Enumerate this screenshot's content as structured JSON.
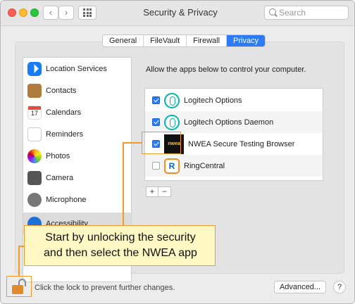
{
  "window": {
    "title": "Security & Privacy"
  },
  "toolbar": {
    "back_glyph": "‹",
    "forward_glyph": "›",
    "grid_icon": "grid-icon"
  },
  "search": {
    "placeholder": "Search"
  },
  "tabs": [
    {
      "label": "General",
      "active": false
    },
    {
      "label": "FileVault",
      "active": false
    },
    {
      "label": "Firewall",
      "active": false
    },
    {
      "label": "Privacy",
      "active": true
    }
  ],
  "sidebar": {
    "items": [
      {
        "label": "Location Services",
        "icon": "location-icon"
      },
      {
        "label": "Contacts",
        "icon": "contacts-icon"
      },
      {
        "label": "Calendars",
        "icon": "calendar-icon",
        "badge": "17"
      },
      {
        "label": "Reminders",
        "icon": "reminders-icon"
      },
      {
        "label": "Photos",
        "icon": "photos-icon"
      },
      {
        "label": "Camera",
        "icon": "camera-icon"
      },
      {
        "label": "Microphone",
        "icon": "microphone-icon"
      },
      {
        "label": "Accessibility",
        "icon": "accessibility-icon",
        "selected": true
      }
    ]
  },
  "main": {
    "description": "Allow the apps below to control your computer.",
    "apps": [
      {
        "name": "Logitech Options",
        "checked": true,
        "icon": "logitech-icon"
      },
      {
        "name": "Logitech Options Daemon",
        "checked": true,
        "icon": "logitech-icon"
      },
      {
        "name": "NWEA Secure Testing Browser",
        "checked": true,
        "icon": "nwea-icon",
        "icon_text": "nwea"
      },
      {
        "name": "RingCentral",
        "checked": false,
        "icon": "ringcentral-icon",
        "icon_text": "R"
      }
    ],
    "add_label": "+",
    "remove_label": "−"
  },
  "callout": {
    "line1": "Start by unlocking the security",
    "line2": "and then select the NWEA app"
  },
  "footer": {
    "lock_text": "Click the lock to prevent further changes.",
    "advanced_label": "Advanced...",
    "help_label": "?"
  },
  "colors": {
    "accent": "#2b7cf6",
    "highlight": "#f39a2b",
    "callout_bg": "#fff8c4"
  }
}
